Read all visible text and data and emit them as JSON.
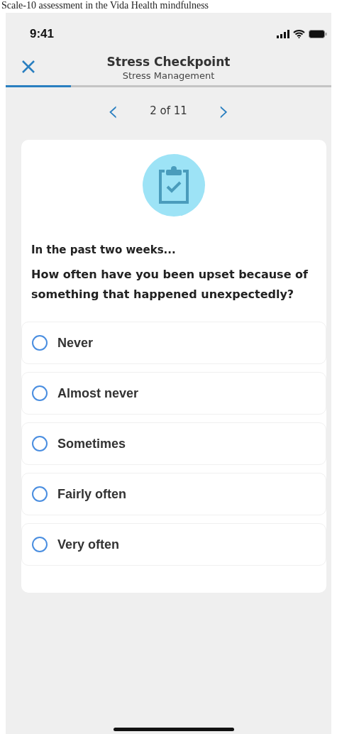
{
  "caption": "Scale-10 assessment in the Vida Health mindfulness",
  "status_bar": {
    "time": "9:41"
  },
  "header": {
    "title": "Stress Checkpoint",
    "subtitle": "Stress Management",
    "progress": {
      "level": 0.2
    }
  },
  "pager": {
    "prev": "‹",
    "label": "2 of 11",
    "next": "›"
  },
  "question": {
    "intro": "In the past two weeks...",
    "text": "How often have you been upset because of something that happened unexpectedly?",
    "options": [
      {
        "label": "Never",
        "selected": false
      },
      {
        "label": "Almost never",
        "selected": false
      },
      {
        "label": "Sometimes",
        "selected": false
      },
      {
        "label": "Fairly often",
        "selected": false
      },
      {
        "label": "Very often",
        "selected": false
      }
    ]
  }
}
